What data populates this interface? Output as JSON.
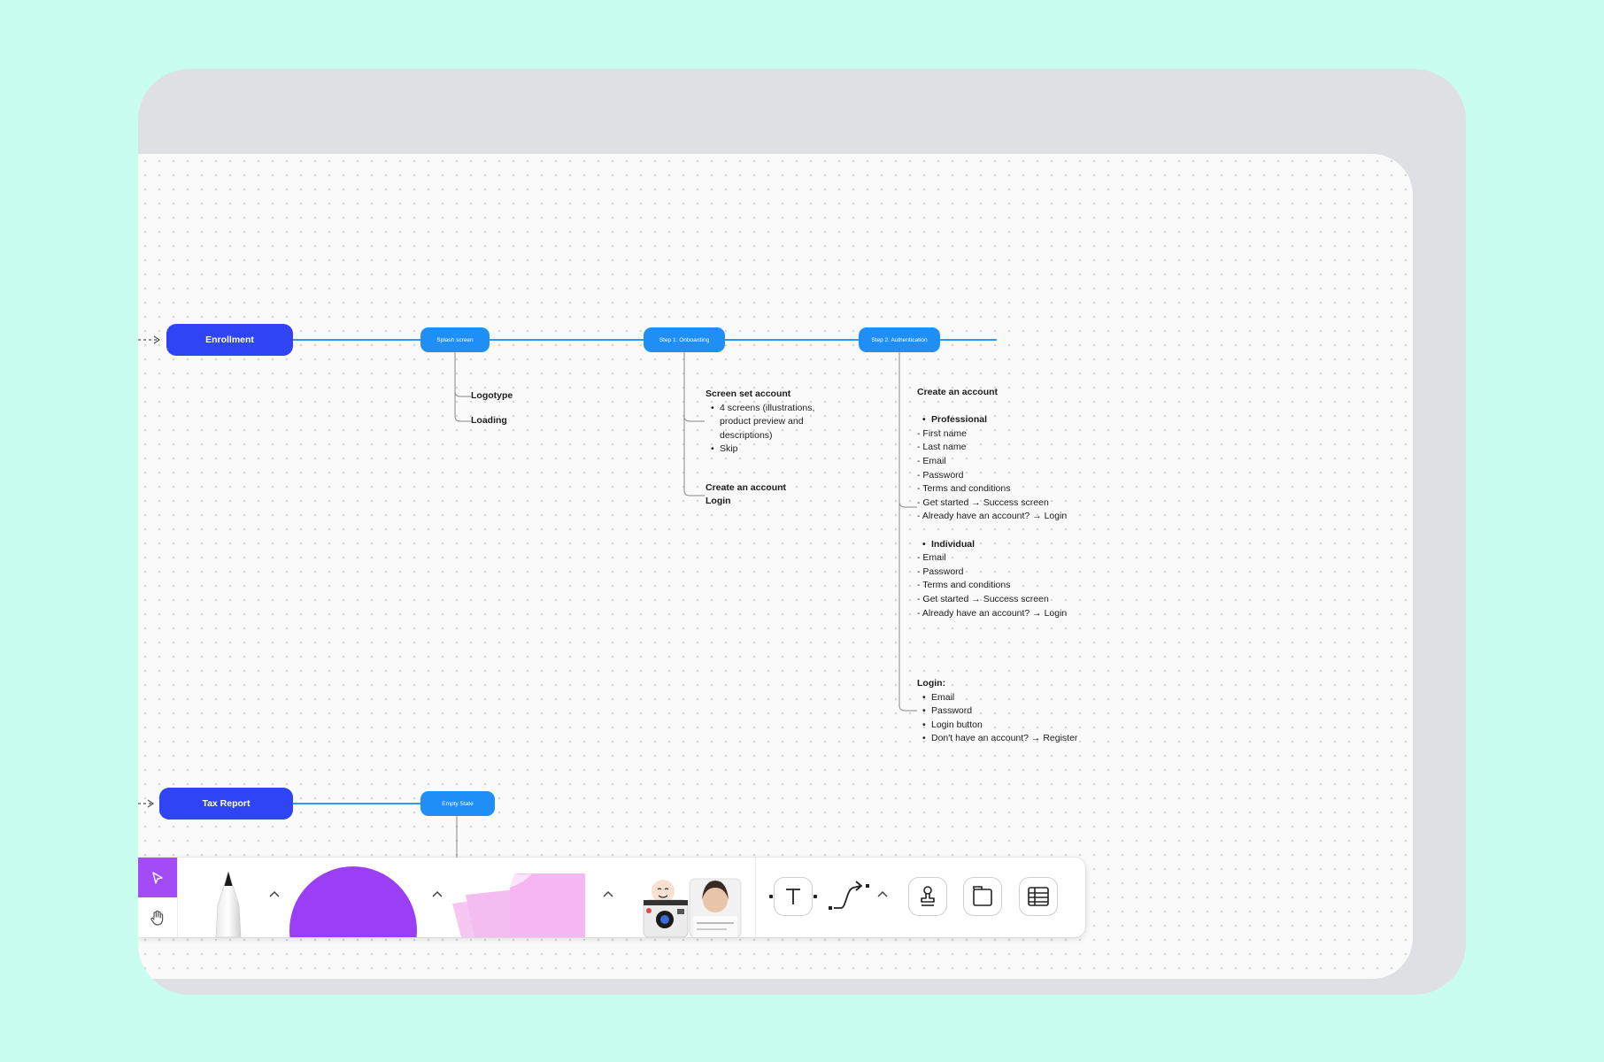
{
  "flow": {
    "enrollment": {
      "label": "Enrollment",
      "steps": [
        "Splash screen",
        "Step 1: Onboarding",
        "Step 2: Authentication"
      ]
    },
    "tax_report": {
      "label": "Tax Report",
      "steps": [
        "Empty State"
      ]
    }
  },
  "notes": {
    "splash": [
      "Logotype",
      "Loading"
    ],
    "onboarding": {
      "title": "Screen set account",
      "bullets": [
        "4 screens (illustrations,",
        "product preview and",
        "descriptions)",
        "Skip"
      ],
      "links": [
        "Create an account",
        "Login"
      ]
    },
    "authentication": {
      "title": "Create an account",
      "professional": {
        "heading": "Professional",
        "items": [
          "- First name",
          "- Last name",
          "- Email",
          "- Password",
          "- Terms and conditions",
          "- Get started → Success screen",
          "- Already have an account? → Login"
        ]
      },
      "individual": {
        "heading": "Individual",
        "items": [
          "- Email",
          "- Password",
          "- Terms and conditions",
          "- Get started → Success screen",
          "- Already have an account? → Login"
        ]
      },
      "login": {
        "heading": "Login:",
        "items": [
          "Email",
          "Password",
          "Login button",
          "Don't have an account? → Register"
        ]
      }
    }
  },
  "toolbar": {
    "tools": [
      "select-tool",
      "hand-tool",
      "pen-tool",
      "shape-tool",
      "sticky-note-tool",
      "media-stickers",
      "text-tool",
      "connector-tool",
      "stamp-tool",
      "section-tool",
      "table-tool"
    ],
    "active_tool": "select-tool"
  },
  "colors": {
    "background": "#c9fdf0",
    "frame": "#dfe0e4",
    "primary_node": "#2f44f5",
    "step_node": "#1f8ff6",
    "active_tool": "#a24bf7",
    "shape": "#9b3ff6",
    "sticky": "#f4b5f0"
  }
}
